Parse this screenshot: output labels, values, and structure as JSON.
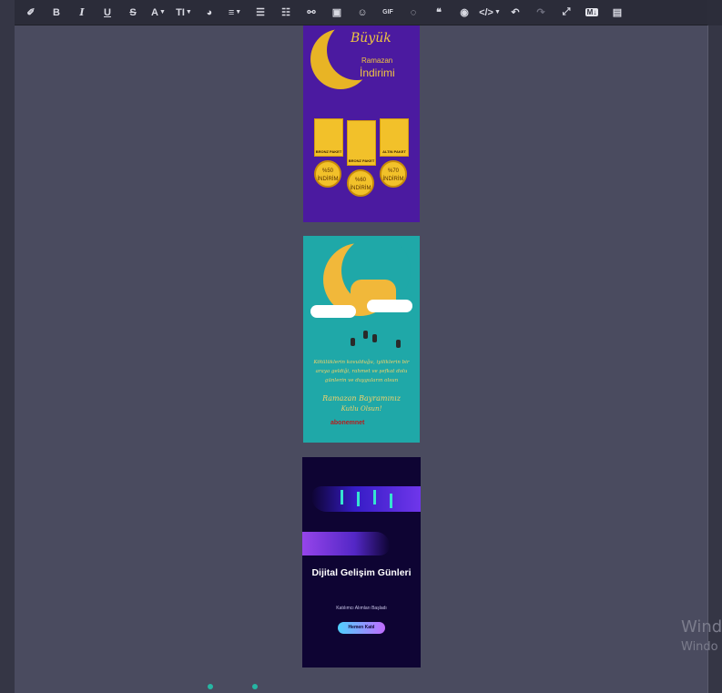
{
  "toolbar": {
    "items": [
      {
        "name": "eraser-icon",
        "glyph": "✐"
      },
      {
        "name": "bold-button",
        "glyph": "B"
      },
      {
        "name": "italic-button",
        "glyph": "I"
      },
      {
        "name": "underline-button",
        "glyph": "U"
      },
      {
        "name": "strikethrough-button",
        "glyph": "S"
      },
      {
        "name": "font-color-dropdown",
        "glyph": "A"
      },
      {
        "name": "font-size-dropdown",
        "glyph": "TI"
      },
      {
        "name": "palette-icon",
        "glyph": "◕"
      },
      {
        "name": "align-dropdown",
        "glyph": "≡"
      },
      {
        "name": "bullet-list-icon",
        "glyph": "☰"
      },
      {
        "name": "numbered-list-icon",
        "glyph": "☷"
      },
      {
        "name": "link-icon",
        "glyph": "⚯"
      },
      {
        "name": "image-icon",
        "glyph": "▣"
      },
      {
        "name": "emoji-icon",
        "glyph": "☺"
      },
      {
        "name": "gif-button",
        "glyph": "GIF"
      },
      {
        "name": "comment-icon",
        "glyph": "◌"
      },
      {
        "name": "quote-icon",
        "glyph": "❝"
      },
      {
        "name": "preview-icon",
        "glyph": "◉"
      },
      {
        "name": "code-dropdown",
        "glyph": "</>"
      },
      {
        "name": "undo-icon",
        "glyph": "↶"
      },
      {
        "name": "redo-icon",
        "glyph": "↷"
      },
      {
        "name": "fullscreen-icon",
        "glyph": "⤢"
      },
      {
        "name": "markdown-button",
        "glyph": "M↓"
      },
      {
        "name": "document-icon",
        "glyph": "▤"
      }
    ]
  },
  "images": {
    "ramadan_sale": {
      "title_line1": "Büyük",
      "title_line2": "Ramazan",
      "title_line3": "İndirimi",
      "packages": [
        "BRONZ PAKET",
        "BRONZ PAKET",
        "ALTIN PAKET"
      ],
      "discounts": [
        "%50 İNDİRİM",
        "%60 İNDİRİM",
        "%70 İNDİRİM"
      ]
    },
    "ramadan_greeting": {
      "message": "Kötülüklerin kovulduğu, iyiliklerin bir araya geldiği, rahmet ve şefkat dolu günlerin ve duyguların olsun",
      "headline": "Ramazan Bayramınız",
      "closing": "Kutlu Olsun!",
      "logo": "abonemnet"
    },
    "digital_days": {
      "title": "Dijital Gelişim Günleri",
      "subtitle": "Katılımcı Alımları Başladı",
      "cta": "Hemen Katıl"
    }
  },
  "watermark": {
    "line1": "Wind",
    "line2": "Windo"
  }
}
